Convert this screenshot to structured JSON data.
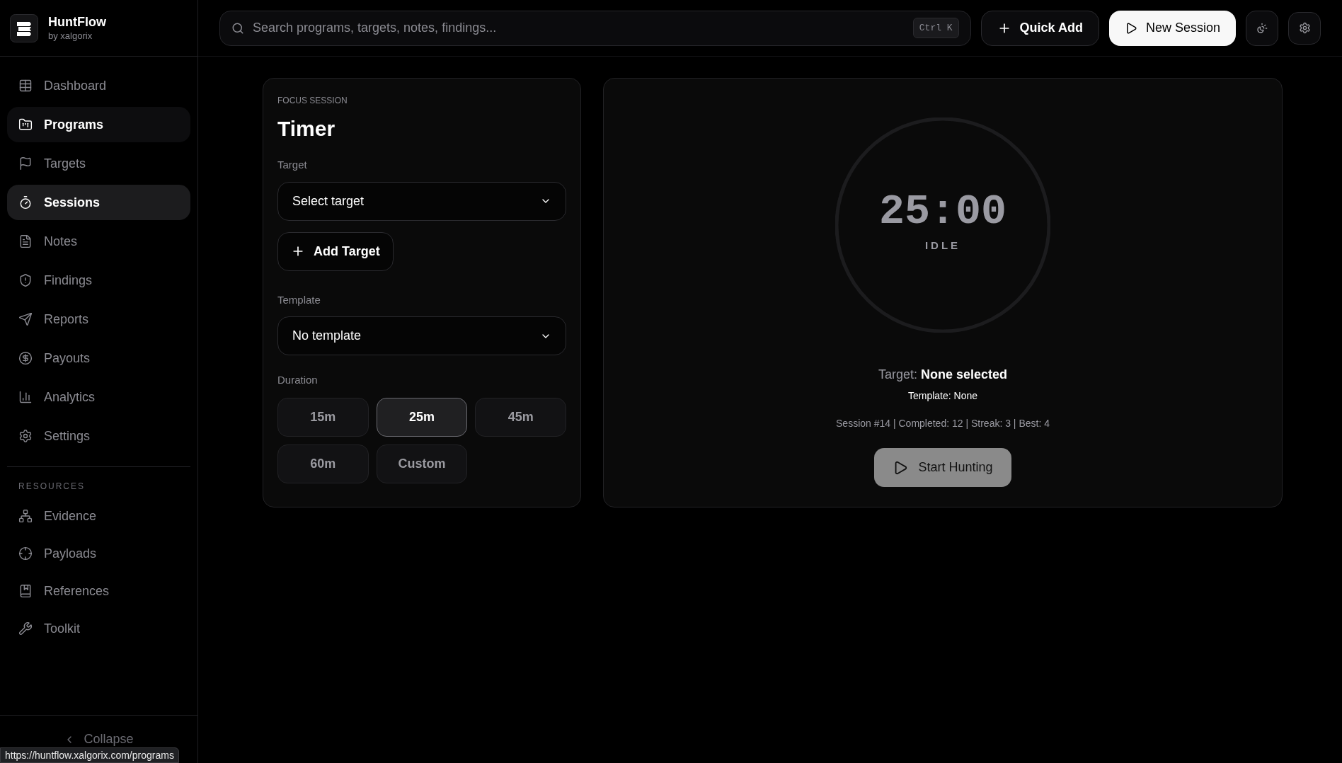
{
  "brand": {
    "name": "HuntFlow",
    "byline": "by xalgorix"
  },
  "sidebar": {
    "items": [
      {
        "label": "Dashboard",
        "selected": false,
        "hovered": false
      },
      {
        "label": "Programs",
        "selected": false,
        "hovered": true
      },
      {
        "label": "Targets",
        "selected": false,
        "hovered": false
      },
      {
        "label": "Sessions",
        "selected": true,
        "hovered": false
      },
      {
        "label": "Notes",
        "selected": false,
        "hovered": false
      },
      {
        "label": "Findings",
        "selected": false,
        "hovered": false
      },
      {
        "label": "Reports",
        "selected": false,
        "hovered": false
      },
      {
        "label": "Payouts",
        "selected": false,
        "hovered": false
      },
      {
        "label": "Analytics",
        "selected": false,
        "hovered": false
      },
      {
        "label": "Settings",
        "selected": false,
        "hovered": false
      }
    ],
    "section_title": "RESOURCES",
    "resources": [
      {
        "label": "Evidence"
      },
      {
        "label": "Payloads"
      },
      {
        "label": "References"
      },
      {
        "label": "Toolkit"
      }
    ],
    "collapse": "Collapse"
  },
  "status_bar": "https://huntflow.xalgorix.com/programs",
  "header": {
    "search_placeholder": "Search programs, targets, notes, findings...",
    "shortcut": "Ctrl K",
    "quick_add": "Quick Add",
    "new_session": "New Session"
  },
  "timer_card": {
    "eyebrow": "FOCUS SESSION",
    "title": "Timer",
    "target": {
      "label": "Target",
      "value": "Select target"
    },
    "add_target": "Add Target",
    "template": {
      "label": "Template",
      "value": "No template"
    },
    "duration_label": "Duration",
    "durations": [
      {
        "label": "15m",
        "selected": false
      },
      {
        "label": "25m",
        "selected": true
      },
      {
        "label": "45m",
        "selected": false
      },
      {
        "label": "60m",
        "selected": false
      },
      {
        "label": "Custom",
        "selected": false
      }
    ]
  },
  "clock": {
    "time": "25:00",
    "status": "IDLE",
    "level": 0,
    "target_label": "Target:",
    "target_value": "None selected",
    "template_line": "Template: None",
    "stats": "Session #14 | Completed: 12 | Streak: 3 | Best: 4",
    "start": "Start Hunting"
  }
}
